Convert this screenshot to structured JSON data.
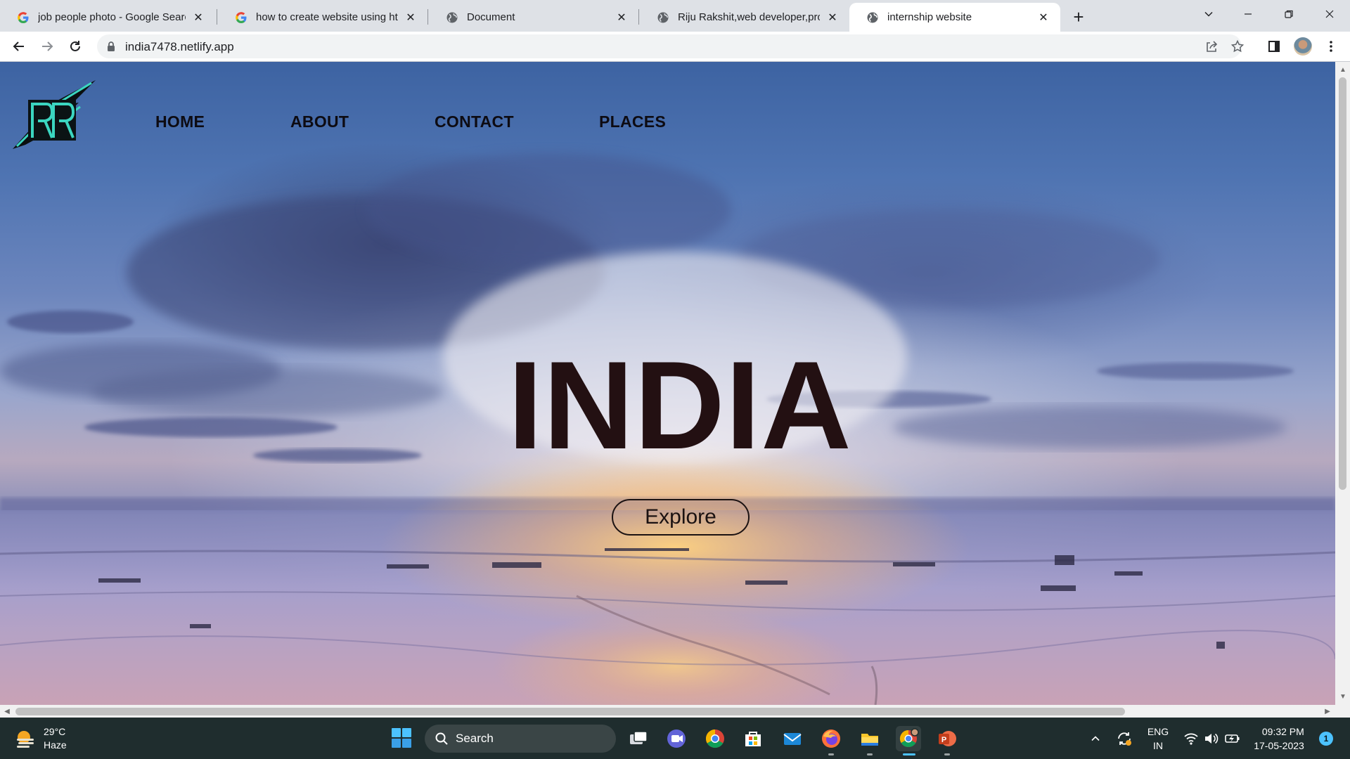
{
  "browser": {
    "tabs": [
      {
        "title": "job people photo - Google Searc",
        "favicon": "google-icon",
        "active": false
      },
      {
        "title": "how to create website using html",
        "favicon": "google-icon",
        "active": false
      },
      {
        "title": "Document",
        "favicon": "globe-icon",
        "active": false
      },
      {
        "title": "Riju Rakshit,web developer,progr",
        "favicon": "globe-icon",
        "active": false
      },
      {
        "title": "internship website",
        "favicon": "globe-icon",
        "active": true
      }
    ],
    "url": "india7478.netlify.app"
  },
  "page": {
    "nav": [
      {
        "label": "HOME"
      },
      {
        "label": "ABOUT"
      },
      {
        "label": "CONTACT"
      },
      {
        "label": "PLACES"
      }
    ],
    "hero_title": "INDIA",
    "explore_label": "Explore"
  },
  "taskbar": {
    "weather": {
      "temp": "29°C",
      "condition": "Haze"
    },
    "search_label": "Search",
    "apps": [
      "task-view-icon",
      "teams-icon",
      "chrome-icon",
      "store-icon",
      "mail-icon",
      "firefox-icon",
      "file-explorer-icon",
      "chrome-profile-icon",
      "powerpoint-icon"
    ],
    "language": {
      "line1": "ENG",
      "line2": "IN"
    },
    "clock": {
      "time": "09:32 PM",
      "date": "17-05-2023"
    },
    "notifications": "1"
  },
  "colors": {
    "accent": "#4cc2ff",
    "hero_text": "#231012",
    "taskbar_bg": "#1f2d2e"
  }
}
